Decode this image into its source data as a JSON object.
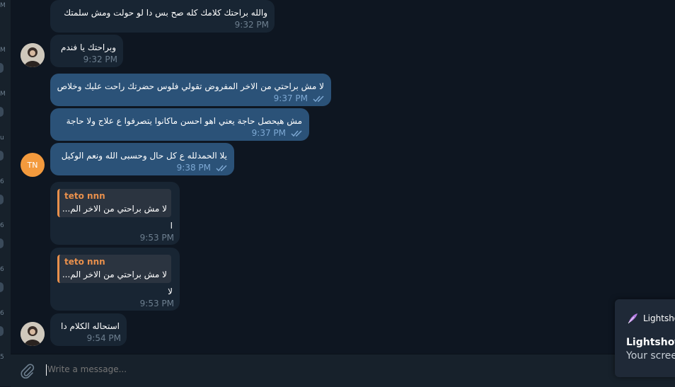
{
  "left_strip_letters": [
    "M",
    "M",
    "M",
    "u",
    "6",
    "6",
    "6",
    "6",
    "5"
  ],
  "messages": [
    {
      "text": "والله براحتك كلامك كله صح بس دا لو حولت ومش سلمتك",
      "time": "9:32 PM"
    },
    {
      "text": "وبراحتك يا فندم",
      "time": "9:32 PM"
    },
    {
      "text": "لا مش براحتي من الاخر المفروض تقولي فلوس حضرتك راحت عليك وخلاص",
      "time": "9:37 PM"
    },
    {
      "text": "مش هيحصل حاجة يعني اهو احسن ماكانوا يتصرفوا ع علاج ولا حاجة",
      "time": "9:37 PM"
    },
    {
      "text": "يلا الحمدلله ع كل حال وحسبى الله ونعم الوكيل",
      "time": "9:38 PM"
    },
    {
      "reply_name": "teto nnn",
      "reply_text": "لا مش براحتي من الاخر الم...",
      "text": "ا",
      "time": "9:53 PM"
    },
    {
      "reply_name": "teto nnn",
      "reply_text": "لا مش براحتي من الاخر الم...",
      "text": "لا",
      "time": "9:53 PM"
    },
    {
      "text": "استحاله الكلام دا",
      "time": "9:54 PM"
    }
  ],
  "avatar_initials": "TN",
  "composer": {
    "placeholder": "Write a message..."
  },
  "toast": {
    "app_small": "Lightsho",
    "title": "Lightshot",
    "subtitle": "Your scree"
  },
  "colors": {
    "background": "#0e1621",
    "incoming_bubble": "#182533",
    "outgoing_bubble": "#2b5278",
    "reply_accent": "#e9904c",
    "avatar_tn": "#f39a3d"
  },
  "icons": [
    "paperclip-icon",
    "double-check-icon",
    "lightshot-feather-icon"
  ]
}
